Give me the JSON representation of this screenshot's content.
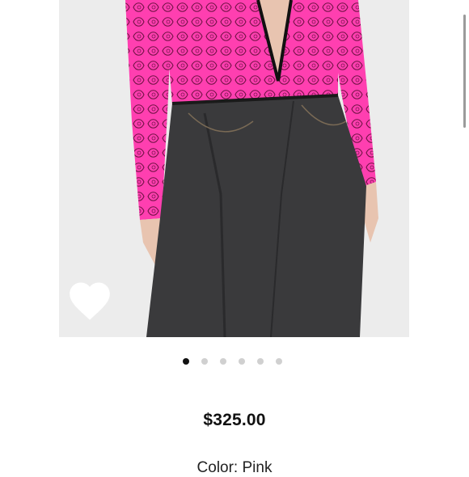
{
  "product": {
    "price": "$325.00",
    "color_label": "Color: Pink"
  },
  "carousel": {
    "slides": 6,
    "active_index": 0
  },
  "icons": {
    "wishlist": "heart-icon"
  },
  "colors": {
    "background": "#ffffff",
    "active_dot": "#111111",
    "inactive_dot": "#d0d0d0",
    "top_pink": "#ff3fb0",
    "jeans": "#3a3a3c"
  }
}
